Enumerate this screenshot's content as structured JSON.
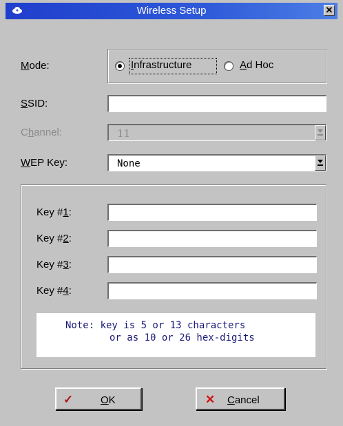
{
  "window": {
    "title": "Wireless Setup",
    "close_glyph": "✕"
  },
  "mode": {
    "label_prefix": "",
    "label_hot": "M",
    "label_rest": "ode:",
    "options": [
      {
        "prefix": "",
        "hot": "I",
        "rest": "nfrastructure",
        "selected": true
      },
      {
        "prefix": "",
        "hot": "A",
        "rest": "d Hoc",
        "selected": false
      }
    ]
  },
  "ssid": {
    "label_hot": "S",
    "label_rest": "SID:",
    "value": ""
  },
  "channel": {
    "label_pre": "C",
    "label_hot": "h",
    "label_rest": "annel:",
    "value": "11",
    "enabled": false
  },
  "wep": {
    "label_hot": "W",
    "label_rest": "EP Key:",
    "value": "None"
  },
  "keys": [
    {
      "label_pre": "Key #",
      "label_hot": "1",
      "label_post": ":",
      "value": ""
    },
    {
      "label_pre": "Key #",
      "label_hot": "2",
      "label_post": ":",
      "value": ""
    },
    {
      "label_pre": "Key #",
      "label_hot": "3",
      "label_post": ":",
      "value": ""
    },
    {
      "label_pre": "Key #",
      "label_hot": "4",
      "label_post": ":",
      "value": ""
    }
  ],
  "note": {
    "line1": "Note: key is 5 or 13 characters",
    "line2": "or as 10 or 26 hex-digits"
  },
  "buttons": {
    "ok": {
      "hot": "O",
      "rest": "K",
      "icon": "✓",
      "icon_color": "#b01818"
    },
    "cancel": {
      "hot": "C",
      "rest": "ancel",
      "icon": "✕",
      "icon_color": "#d01010"
    }
  }
}
